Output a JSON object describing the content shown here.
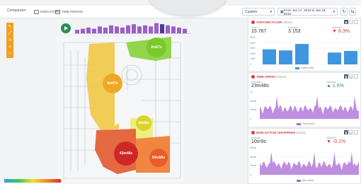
{
  "topbar": {
    "comparator": "Comparator",
    "indicators": "INDICATORS",
    "time_period": "TIME PERIOD",
    "custom": "Custom",
    "date_range": "From Jan 17, 2018 to Jan 23, 2018"
  },
  "map": {
    "zones": [
      {
        "label": "2m07s",
        "color": "#7ad12b"
      },
      {
        "label": "5m07s",
        "color": "#f0a728"
      },
      {
        "label": "4m08s",
        "color": "#d9d524"
      },
      {
        "label": "42m48s",
        "color": "#d32a25"
      },
      {
        "label": "54m56s",
        "color": "#ec5d2c"
      }
    ],
    "timeline_bars": [
      3,
      4,
      5,
      4,
      6,
      5,
      7,
      6,
      5,
      7,
      8,
      6,
      7,
      6,
      9,
      8,
      7,
      6,
      5,
      4
    ]
  },
  "panels": {
    "flow": {
      "title": "VISITORS FLOW",
      "subtitle": "history",
      "metrics": [
        {
          "label": "Total",
          "value": "15 767"
        },
        {
          "label": "Average",
          "value": "3 153"
        },
        {
          "label": "Variation",
          "value": "▼ 8.3%"
        }
      ],
      "y_ticks": [
        "5000",
        "4000",
        "3000",
        "2000",
        "1000",
        "0"
      ],
      "legend": "Visitors flow"
    },
    "time_spent": {
      "title": "TIME SPENT",
      "subtitle": "history",
      "metrics": [
        {
          "label": "Average",
          "value": "23m48s"
        },
        {
          "label": "Variation",
          "value": "▲ 1.6%"
        }
      ],
      "y_ticks": [
        "1h",
        "40min",
        "20min",
        "0"
      ],
      "legend": "Time spent"
    },
    "non_active": {
      "title": "NON-ACTIVE SHOPPERS",
      "subtitle": "history",
      "metrics": [
        {
          "label": "Average",
          "value": "10m9s"
        },
        {
          "label": "Variation",
          "value": "▼ -0.1%"
        }
      ],
      "y_ticks": [
        "60min",
        "40min",
        "20min",
        "0"
      ],
      "legend": "Non-active"
    }
  },
  "colors": {
    "accent_orange": "#f2a024",
    "bar_blue": "#3e96e0",
    "area_purple": "#a86ad6",
    "alert_red": "#d13f3a"
  }
}
